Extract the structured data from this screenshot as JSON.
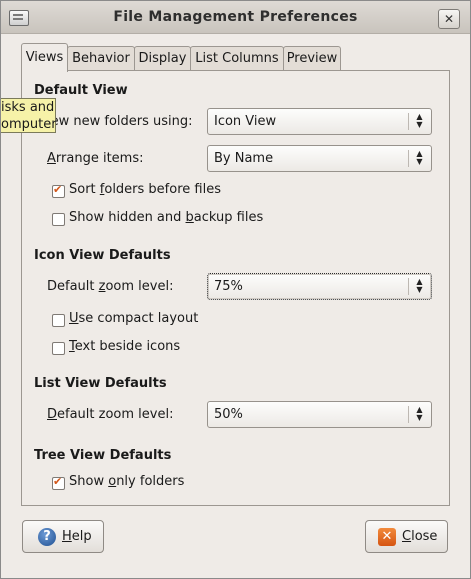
{
  "window": {
    "title": "File Management Preferences"
  },
  "tabs": [
    {
      "label": "Views"
    },
    {
      "label": "Behavior"
    },
    {
      "label": "Display"
    },
    {
      "label": "List Columns"
    },
    {
      "label": "Preview"
    }
  ],
  "tooltip": {
    "line1": "isks and",
    "line2": "omputer"
  },
  "default_view": {
    "heading": "Default View",
    "view_new_label": "iew new folders using:",
    "view_new_value": "Icon View",
    "arrange_label_mnemonic": "A",
    "arrange_label_rest": "rrange items:",
    "arrange_value": "By Name",
    "sort_folders": {
      "pre": "Sort ",
      "mn": "f",
      "post": "olders before files",
      "checked": true
    },
    "show_hidden": {
      "pre": "Show hidden and ",
      "mn": "b",
      "post": "ackup files",
      "checked": false
    }
  },
  "icon_view": {
    "heading": "Icon View Defaults",
    "zoom_pre": "Default ",
    "zoom_mn": "z",
    "zoom_post": "oom level:",
    "zoom_value": "75%",
    "compact": {
      "mn": "U",
      "post": "se compact layout",
      "checked": false
    },
    "text_beside": {
      "mn": "T",
      "post": "ext beside icons",
      "checked": false
    }
  },
  "list_view": {
    "heading": "List View Defaults",
    "zoom_pre": "",
    "zoom_mn": "D",
    "zoom_post": "efault zoom level:",
    "zoom_value": "50%"
  },
  "tree_view": {
    "heading": "Tree View Defaults",
    "only_folders": {
      "pre": "Show ",
      "mn": "o",
      "post": "nly folders",
      "checked": true
    }
  },
  "buttons": {
    "help": {
      "mn": "H",
      "post": "elp"
    },
    "close": {
      "mn": "C",
      "post": "lose"
    }
  },
  "colors": {
    "accent": "#d2571a",
    "tooltip_bg": "#f6f2a8",
    "window_bg": "#efebe7"
  }
}
